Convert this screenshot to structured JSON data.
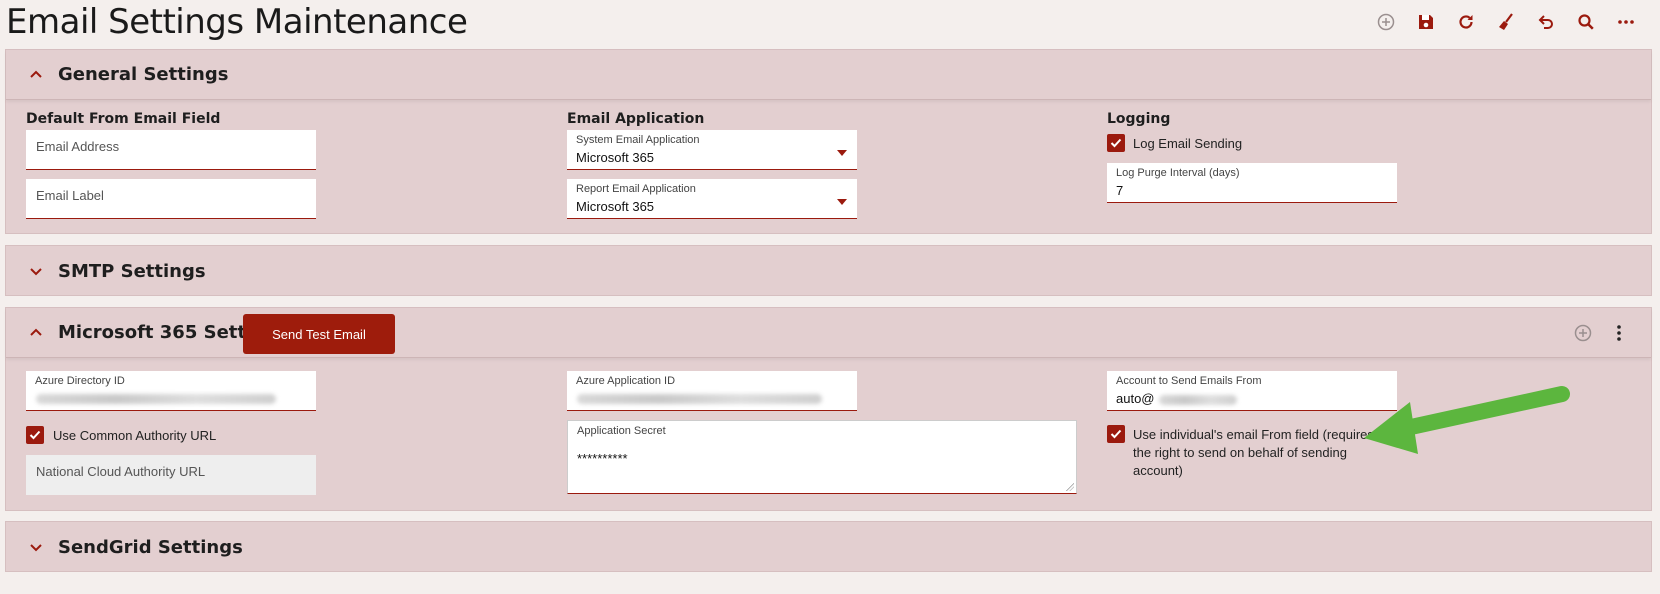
{
  "page": {
    "title": "Email Settings Maintenance"
  },
  "toolbar": [
    {
      "name": "add-icon"
    },
    {
      "name": "save-icon"
    },
    {
      "name": "refresh-icon"
    },
    {
      "name": "broom-icon"
    },
    {
      "name": "undo-icon"
    },
    {
      "name": "search-icon"
    },
    {
      "name": "more-icon"
    }
  ],
  "colors": {
    "accent": "#9b1a0e",
    "panel": "#e3cfd0",
    "background": "#f4efed"
  },
  "general": {
    "title": "General Settings",
    "default_from": {
      "label": "Default From Email Field",
      "email_address_placeholder": "Email Address",
      "email_label_placeholder": "Email Label"
    },
    "email_app": {
      "label": "Email Application",
      "system_label": "System Email Application",
      "system_value": "Microsoft 365",
      "report_label": "Report Email Application",
      "report_value": "Microsoft 365"
    },
    "logging": {
      "label": "Logging",
      "log_sending_label": "Log Email Sending",
      "log_sending_checked": true,
      "purge_label": "Log Purge Interval (days)",
      "purge_value": "7"
    }
  },
  "smtp": {
    "title": "SMTP Settings"
  },
  "ms365": {
    "title": "Microsoft 365 Settings",
    "send_test_label": "Send Test Email",
    "azure_directory_label": "Azure Directory ID",
    "use_common_authority_label": "Use Common Authority URL",
    "use_common_authority_checked": true,
    "national_cloud_placeholder": "National Cloud Authority URL",
    "azure_app_label": "Azure Application ID",
    "app_secret_label": "Application Secret",
    "app_secret_value": "**********",
    "account_label": "Account to Send Emails From",
    "account_value": "auto@",
    "individual_from_label": "Use individual's email From field (requires the right to send on behalf of sending account)",
    "individual_from_checked": true
  },
  "sendgrid": {
    "title": "SendGrid Settings"
  }
}
